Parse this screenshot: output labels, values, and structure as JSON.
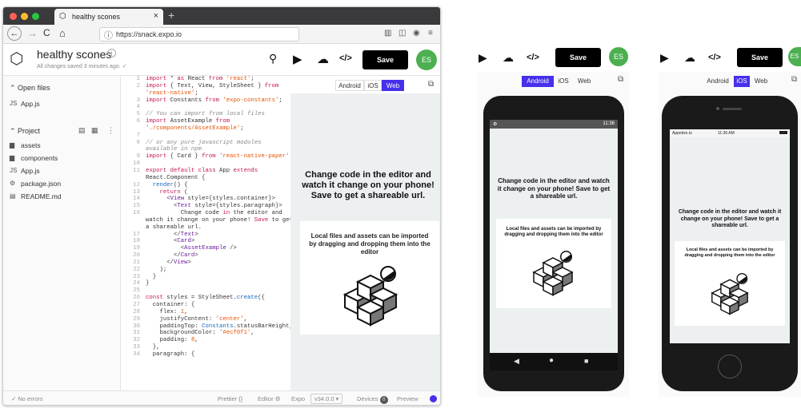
{
  "browser": {
    "tab_title": "healthy scones",
    "tab_close": "×",
    "new_tab": "+",
    "url": "https://snack.expo.io",
    "back": "←",
    "forward": "→",
    "reload": "C",
    "home": "⌂"
  },
  "header": {
    "project_name": "healthy scones",
    "saved_status": "All changes saved 3 minutes ago. ✓",
    "save_label": "Save",
    "avatar": "ES"
  },
  "sidebar": {
    "open_files_label": "Open files",
    "open_files": [
      {
        "name": "App.js"
      }
    ],
    "project_label": "Project",
    "project_items": [
      {
        "name": "assets",
        "icon": "folder-icon"
      },
      {
        "name": "components",
        "icon": "folder-icon"
      },
      {
        "name": "App.js",
        "icon": "file-js-icon"
      },
      {
        "name": "package.json",
        "icon": "file-gear-icon"
      },
      {
        "name": "README.md",
        "icon": "file-md-icon"
      }
    ]
  },
  "editor": {
    "line_numbers": [
      "1",
      "2",
      "",
      "3",
      "4",
      "5",
      "6",
      "",
      "7",
      "8",
      "",
      "9",
      "10",
      "11",
      "",
      "12",
      "13",
      "14",
      "15",
      "16",
      "",
      "",
      "17",
      "18",
      "19",
      "20",
      "21",
      "22",
      "23",
      "24",
      "25",
      "26",
      "27",
      "28",
      "29",
      "30",
      "31",
      "32",
      "33",
      "34"
    ]
  },
  "preview": {
    "platforms": [
      "Android",
      "iOS",
      "Web"
    ],
    "selected": "Web",
    "title": "Change code in the editor and watch it change on your phone! Save to get a shareable url.",
    "card_text": "Local files and assets can be imported by dragging and dropping them into the editor"
  },
  "status": {
    "errors": "No errors",
    "prettier": "Prettier",
    "prettier_braces": "{}",
    "editor": "Editor",
    "expo": "Expo",
    "version": "v34.0.0 ▾",
    "devices": "Devices",
    "devices_count": "0",
    "preview": "Preview"
  },
  "android_phone": {
    "save_label": "Save",
    "avatar": "ES",
    "platforms": [
      "Android",
      "iOS",
      "Web"
    ],
    "selected": "Android",
    "status_time": "11:36",
    "title": "Change code in the editor and watch it change on your phone! Save to get a shareable url.",
    "card_text": "Local files and assets can be imported by dragging and dropping them into the editor"
  },
  "ios_phone": {
    "save_label": "Save",
    "avatar": "ES",
    "platforms": [
      "Android",
      "iOS",
      "Web"
    ],
    "selected": "iOS",
    "carrier": "Appetize.io",
    "status_time": "11:36 AM",
    "title": "Change code in the editor and watch it change on your phone! Save to get a shareable url.",
    "card_text": "Local files and assets can be imported by dragging and dropping them into the editor"
  },
  "colors": {
    "accent": "#4630eb",
    "avatar": "#4caf50",
    "preview_bg": "#ecf0f1"
  }
}
